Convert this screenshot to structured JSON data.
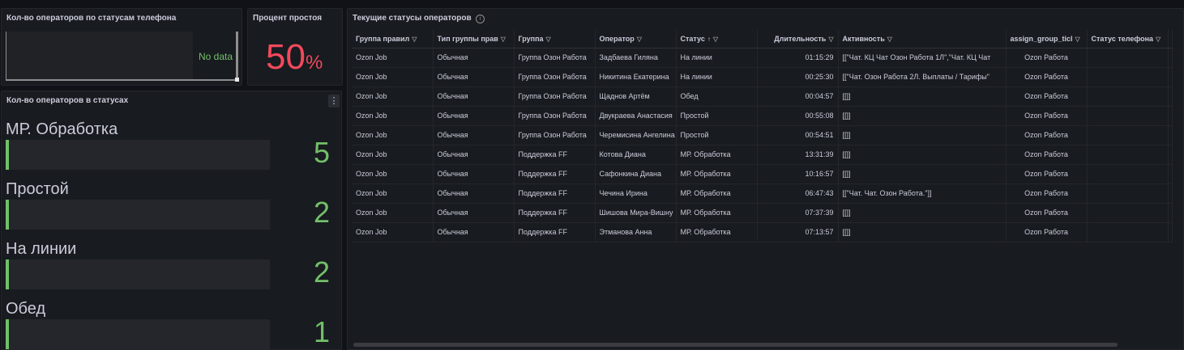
{
  "panels": {
    "phone_status": {
      "title": "Кол-во операторов по статусам телефона",
      "no_data": "No data"
    },
    "idle_percent": {
      "title": "Процент простоя",
      "value": "50",
      "unit": "%",
      "color": "#f2495c"
    },
    "status_counts": {
      "title": "Кол-во операторов в статусах",
      "menu_icon": "more-vertical-icon",
      "items": [
        {
          "label": "МР. Обработка",
          "value": "5"
        },
        {
          "label": "Простой",
          "value": "2"
        },
        {
          "label": "На линии",
          "value": "2"
        },
        {
          "label": "Обед",
          "value": "1"
        }
      ],
      "fill_color": "#73bf69"
    },
    "current_statuses": {
      "title": "Текущие статусы операторов",
      "columns": [
        "Группа правил",
        "Тип группы прав",
        "Группа",
        "Оператор",
        "Статус",
        "Длительность",
        "Активность",
        "assign_group_ticl",
        "Статус телефона",
        ""
      ],
      "rows": [
        [
          "Ozon Job",
          "Обычная",
          "Группа Озон Работа",
          "Задбаева Гиляна",
          "На линии",
          "01:15:29",
          "[[\"Чат. КЦ Чат Озон Работа 1Л\",\"Чат. КЦ Чат",
          "Ozon Работа",
          "",
          ""
        ],
        [
          "Ozon Job",
          "Обычная",
          "Группа Озон Работа",
          "Никитина Екатерина",
          "На линии",
          "00:25:30",
          "[[\"Чат. Озон Работа 2Л. Выплаты / Тарифы\"",
          "Ozon Работа",
          "",
          ""
        ],
        [
          "Ozon Job",
          "Обычная",
          "Группа Озон Работа",
          "Щаднов Артём",
          "Обед",
          "00:04:57",
          "[[]]",
          "Ozon Работа",
          "",
          ""
        ],
        [
          "Ozon Job",
          "Обычная",
          "Группа Озон Работа",
          "Двукраева Анастасия",
          "Простой",
          "00:55:08",
          "[[]]",
          "Ozon Работа",
          "",
          ""
        ],
        [
          "Ozon Job",
          "Обычная",
          "Группа Озон Работа",
          "Черемисина Ангелина",
          "Простой",
          "00:54:51",
          "[[]]",
          "Ozon Работа",
          "",
          ""
        ],
        [
          "Ozon Job",
          "Обычная",
          "Поддержка FF",
          "Котова Диана",
          "МР. Обработка",
          "13:31:39",
          "[[]]",
          "Ozon Работа",
          "",
          ""
        ],
        [
          "Ozon Job",
          "Обычная",
          "Поддержка FF",
          "Сафонкина Диана",
          "МР. Обработка",
          "10:16:57",
          "[[]]",
          "Ozon Работа",
          "",
          ""
        ],
        [
          "Ozon Job",
          "Обычная",
          "Поддержка FF",
          "Чечина Ирина",
          "МР. Обработка",
          "06:47:43",
          "[[\"Чат. Чат. Озон Работа.\"]]",
          "Ozon Работа",
          "",
          ""
        ],
        [
          "Ozon Job",
          "Обычная",
          "Поддержка FF",
          "Шишова Мира-Вишну",
          "МР. Обработка",
          "07:37:39",
          "[[]]",
          "Ozon Работа",
          "",
          ""
        ],
        [
          "Ozon Job",
          "Обычная",
          "Поддержка FF",
          "Этманова Анна",
          "МР. Обработка",
          "07:13:57",
          "[[]]",
          "Ozon Работа",
          "",
          ""
        ]
      ]
    }
  },
  "icons": {
    "filter": "filter-icon",
    "sort": "sort-ascending-icon",
    "info": "info-icon"
  }
}
